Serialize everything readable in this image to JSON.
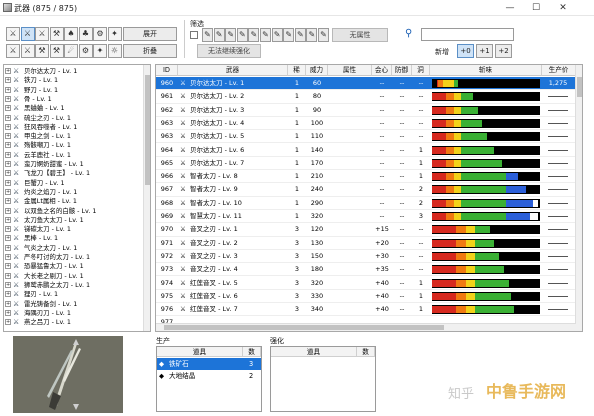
{
  "window": {
    "title": "武器",
    "count": "(875 / 875)",
    "controls": [
      "—",
      "☐",
      "✕"
    ]
  },
  "toolbar": {
    "icons": [
      "sword-icon",
      "greatsword-icon",
      "longsword-icon",
      "hammer-icon",
      "lance-icon",
      "gunlance-icon",
      "switchaxe-icon",
      "chargeblade-icon"
    ],
    "icon_glyphs": [
      "⚔",
      "⚔",
      "⚔",
      "⚒",
      "♠",
      "♣",
      "⚙",
      "✦",
      "⚔",
      "⚔",
      "⚒",
      "⚒",
      "☄",
      "⚙",
      "✦",
      "☼"
    ],
    "expand_label": "展开",
    "collapse_label": "折叠"
  },
  "filter": {
    "title": "筛选",
    "icon_glyphs": [
      "✎",
      "✎",
      "✎",
      "✎",
      "✎",
      "✎",
      "✎",
      "✎",
      "✎",
      "✎",
      "✎"
    ],
    "no_attr_label": "无属性",
    "no_upgrade_label": "无法继续强化",
    "search_placeholder": "",
    "new_label": "新增",
    "new_options": [
      "+0",
      "+1",
      "+2"
    ]
  },
  "tree": {
    "items": [
      "贝尔达太刀 - Lv. 1",
      "铁刀 - Lv. 1",
      "野刀 - Lv. 1",
      "骨 - Lv. 1",
      "黑蛐蛐 - Lv. 1",
      "硫尘之刃 - Lv. 1",
      "狂风吞噬者 - Lv. 1",
      "甲虫之剑 - Lv. 1",
      "殇骸嘲刀 - Lv. 1",
      "云羊鹿社 - Lv. 1",
      "蛮刀婀奶甜蜜 - Lv. 1",
      "飞龙刀【碧王】 - Lv. 1",
      "巨蟹刀 - Lv. 1",
      "灼炎之焰刀 - Lv. 1",
      "金属Lt属相 - Lv. 1",
      "以双鱼之名的白骸 - Lv. 1",
      "太刀鱼大太刀 - Lv. 1",
      "锑碳太刀 - Lv. 1",
      "黑棒 - Lv. 1",
      "气炎之太刀 - Lv. 1",
      "严冬叮讨的太刀 - Lv. 1",
      "恐暴猛鲁太刀 - Lv. 1",
      "大长老之剔刀 - Lv. 1",
      "狮鹫赤鹏之太刀 - Lv. 1",
      "狸刃 - Lv. 1",
      "雷光铸备剑 - Lv. 1",
      "海隅刃刀 - Lv. 1",
      "燕之吕刀 - Lv. 1"
    ]
  },
  "grid": {
    "headers": [
      "ID",
      "武器",
      "稀",
      "威力",
      "属性",
      "会心",
      "防御",
      "洞",
      "斩味",
      "生产价"
    ],
    "rows": [
      {
        "id": "960",
        "name": "贝尔达太刀 - Lv. 1",
        "rarity": "1",
        "power": "60",
        "attr": "",
        "crit": "--",
        "def": "--",
        "slots": "--",
        "price": "1,275",
        "bars": [
          [
            4,
            5,
            "#d6291f"
          ],
          [
            5,
            9,
            "#f07a12"
          ],
          [
            9,
            18,
            "#f2d21a"
          ],
          [
            18,
            22,
            "#3ab034"
          ]
        ],
        "selected": true
      },
      {
        "id": "961",
        "name": "贝尔达太刀 - Lv. 2",
        "rarity": "1",
        "power": "80",
        "attr": "",
        "crit": "--",
        "def": "--",
        "slots": "--",
        "price": "",
        "bars": [
          [
            0,
            12,
            "#d6291f"
          ],
          [
            12,
            18,
            "#f07a12"
          ],
          [
            18,
            24,
            "#f2d21a"
          ],
          [
            24,
            34,
            "#3ab034"
          ]
        ],
        "selected": false
      },
      {
        "id": "962",
        "name": "贝尔达太刀 - Lv. 3",
        "rarity": "1",
        "power": "90",
        "attr": "",
        "crit": "--",
        "def": "--",
        "slots": "--",
        "price": "",
        "bars": [
          [
            0,
            12,
            "#d6291f"
          ],
          [
            12,
            18,
            "#f07a12"
          ],
          [
            18,
            24,
            "#f2d21a"
          ],
          [
            24,
            38,
            "#3ab034"
          ]
        ],
        "selected": false
      },
      {
        "id": "963",
        "name": "贝尔达太刀 - Lv. 4",
        "rarity": "1",
        "power": "100",
        "attr": "",
        "crit": "--",
        "def": "--",
        "slots": "--",
        "price": "",
        "bars": [
          [
            0,
            12,
            "#d6291f"
          ],
          [
            12,
            18,
            "#f07a12"
          ],
          [
            18,
            24,
            "#f2d21a"
          ],
          [
            24,
            42,
            "#3ab034"
          ]
        ],
        "selected": false
      },
      {
        "id": "963",
        "name": "贝尔达太刀 - Lv. 5",
        "rarity": "1",
        "power": "110",
        "attr": "",
        "crit": "--",
        "def": "--",
        "slots": "--",
        "price": "",
        "bars": [
          [
            0,
            12,
            "#d6291f"
          ],
          [
            12,
            18,
            "#f07a12"
          ],
          [
            18,
            24,
            "#f2d21a"
          ],
          [
            24,
            46,
            "#3ab034"
          ]
        ],
        "selected": false
      },
      {
        "id": "964",
        "name": "贝尔达太刀 - Lv. 6",
        "rarity": "1",
        "power": "140",
        "attr": "",
        "crit": "--",
        "def": "--",
        "slots": "1",
        "price": "",
        "bars": [
          [
            0,
            12,
            "#d6291f"
          ],
          [
            12,
            18,
            "#f07a12"
          ],
          [
            18,
            24,
            "#f2d21a"
          ],
          [
            24,
            52,
            "#3ab034"
          ]
        ],
        "selected": false
      },
      {
        "id": "965",
        "name": "贝尔达太刀 - Lv. 7",
        "rarity": "1",
        "power": "170",
        "attr": "",
        "crit": "--",
        "def": "--",
        "slots": "1",
        "price": "",
        "bars": [
          [
            0,
            12,
            "#d6291f"
          ],
          [
            12,
            18,
            "#f07a12"
          ],
          [
            18,
            24,
            "#f2d21a"
          ],
          [
            24,
            58,
            "#3ab034"
          ]
        ],
        "selected": false
      },
      {
        "id": "966",
        "name": "智者太刀 - Lv. 8",
        "rarity": "1",
        "power": "210",
        "attr": "",
        "crit": "--",
        "def": "--",
        "slots": "1",
        "price": "",
        "bars": [
          [
            0,
            12,
            "#d6291f"
          ],
          [
            12,
            18,
            "#f07a12"
          ],
          [
            18,
            24,
            "#f2d21a"
          ],
          [
            24,
            62,
            "#3ab034"
          ],
          [
            62,
            72,
            "#2b5fd9"
          ]
        ],
        "selected": false
      },
      {
        "id": "967",
        "name": "智者太刀 - Lv. 9",
        "rarity": "1",
        "power": "240",
        "attr": "",
        "crit": "--",
        "def": "--",
        "slots": "2",
        "price": "",
        "bars": [
          [
            0,
            12,
            "#d6291f"
          ],
          [
            12,
            18,
            "#f07a12"
          ],
          [
            18,
            24,
            "#f2d21a"
          ],
          [
            24,
            62,
            "#3ab034"
          ],
          [
            62,
            78,
            "#2b5fd9"
          ]
        ],
        "selected": false
      },
      {
        "id": "968",
        "name": "智者太刀 - Lv. 10",
        "rarity": "1",
        "power": "290",
        "attr": "",
        "crit": "--",
        "def": "--",
        "slots": "2",
        "price": "",
        "bars": [
          [
            0,
            12,
            "#d6291f"
          ],
          [
            12,
            18,
            "#f07a12"
          ],
          [
            18,
            24,
            "#f2d21a"
          ],
          [
            24,
            62,
            "#3ab034"
          ],
          [
            62,
            84,
            "#2b5fd9"
          ],
          [
            84,
            88,
            "#ffffff"
          ]
        ],
        "selected": false
      },
      {
        "id": "969",
        "name": "智慧太刀 - Lv. 11",
        "rarity": "1",
        "power": "320",
        "attr": "",
        "crit": "--",
        "def": "--",
        "slots": "3",
        "price": "",
        "bars": [
          [
            0,
            12,
            "#d6291f"
          ],
          [
            12,
            18,
            "#f07a12"
          ],
          [
            18,
            24,
            "#f2d21a"
          ],
          [
            24,
            62,
            "#3ab034"
          ],
          [
            62,
            82,
            "#2b5fd9"
          ],
          [
            82,
            88,
            "#ffffff"
          ]
        ],
        "selected": false
      },
      {
        "id": "970",
        "name": "音叉之刃 - Lv. 1",
        "rarity": "3",
        "power": "120",
        "attr": "",
        "crit": "+15",
        "def": "--",
        "slots": "--",
        "price": "",
        "bars": [
          [
            0,
            20,
            "#d6291f"
          ],
          [
            20,
            28,
            "#f07a12"
          ],
          [
            28,
            36,
            "#f2d21a"
          ],
          [
            36,
            48,
            "#3ab034"
          ]
        ],
        "selected": false
      },
      {
        "id": "971",
        "name": "音叉之刃 - Lv. 2",
        "rarity": "3",
        "power": "130",
        "attr": "",
        "crit": "+20",
        "def": "--",
        "slots": "--",
        "price": "",
        "bars": [
          [
            0,
            20,
            "#d6291f"
          ],
          [
            20,
            28,
            "#f07a12"
          ],
          [
            28,
            36,
            "#f2d21a"
          ],
          [
            36,
            52,
            "#3ab034"
          ]
        ],
        "selected": false
      },
      {
        "id": "972",
        "name": "音叉之刃 - Lv. 3",
        "rarity": "3",
        "power": "150",
        "attr": "",
        "crit": "+30",
        "def": "--",
        "slots": "--",
        "price": "",
        "bars": [
          [
            0,
            20,
            "#d6291f"
          ],
          [
            20,
            28,
            "#f07a12"
          ],
          [
            28,
            36,
            "#f2d21a"
          ],
          [
            36,
            56,
            "#3ab034"
          ]
        ],
        "selected": false
      },
      {
        "id": "973",
        "name": "音叉之刃 - Lv. 4",
        "rarity": "3",
        "power": "180",
        "attr": "",
        "crit": "+35",
        "def": "--",
        "slots": "--",
        "price": "",
        "bars": [
          [
            0,
            20,
            "#d6291f"
          ],
          [
            20,
            28,
            "#f07a12"
          ],
          [
            28,
            36,
            "#f2d21a"
          ],
          [
            36,
            60,
            "#3ab034"
          ]
        ],
        "selected": false
      },
      {
        "id": "974",
        "name": "红莲音叉 - Lv. 5",
        "rarity": "3",
        "power": "320",
        "attr": "",
        "crit": "+40",
        "def": "--",
        "slots": "1",
        "price": "",
        "bars": [
          [
            0,
            20,
            "#d6291f"
          ],
          [
            20,
            28,
            "#f07a12"
          ],
          [
            28,
            36,
            "#f2d21a"
          ],
          [
            36,
            64,
            "#3ab034"
          ]
        ],
        "selected": false
      },
      {
        "id": "975",
        "name": "红莲音叉 - Lv. 6",
        "rarity": "3",
        "power": "330",
        "attr": "",
        "crit": "+40",
        "def": "--",
        "slots": "1",
        "price": "",
        "bars": [
          [
            0,
            20,
            "#d6291f"
          ],
          [
            20,
            28,
            "#f07a12"
          ],
          [
            28,
            36,
            "#f2d21a"
          ],
          [
            36,
            66,
            "#3ab034"
          ]
        ],
        "selected": false
      },
      {
        "id": "976",
        "name": "红莲音叉 - Lv. 7",
        "rarity": "3",
        "power": "340",
        "attr": "",
        "crit": "+40",
        "def": "--",
        "slots": "1",
        "price": "",
        "bars": [
          [
            0,
            20,
            "#d6291f"
          ],
          [
            20,
            28,
            "#f07a12"
          ],
          [
            28,
            36,
            "#f2d21a"
          ],
          [
            36,
            68,
            "#3ab034"
          ]
        ],
        "selected": false
      },
      {
        "id": "977",
        "name": "",
        "rarity": "",
        "power": "",
        "attr": "",
        "crit": "",
        "def": "",
        "slots": "",
        "price": "",
        "bars": [],
        "selected": false
      }
    ]
  },
  "production": {
    "title": "生产",
    "headers": [
      "道具",
      "数"
    ],
    "rows": [
      {
        "item": "铁矿石",
        "qty": "3",
        "selected": true
      },
      {
        "item": "大地结晶",
        "qty": "2",
        "selected": false
      }
    ]
  },
  "upgrade": {
    "title": "强化",
    "headers": [
      "道具",
      "数"
    ],
    "rows": []
  },
  "watermark": {
    "text": "知乎",
    "brand": "中鲁手游网"
  }
}
